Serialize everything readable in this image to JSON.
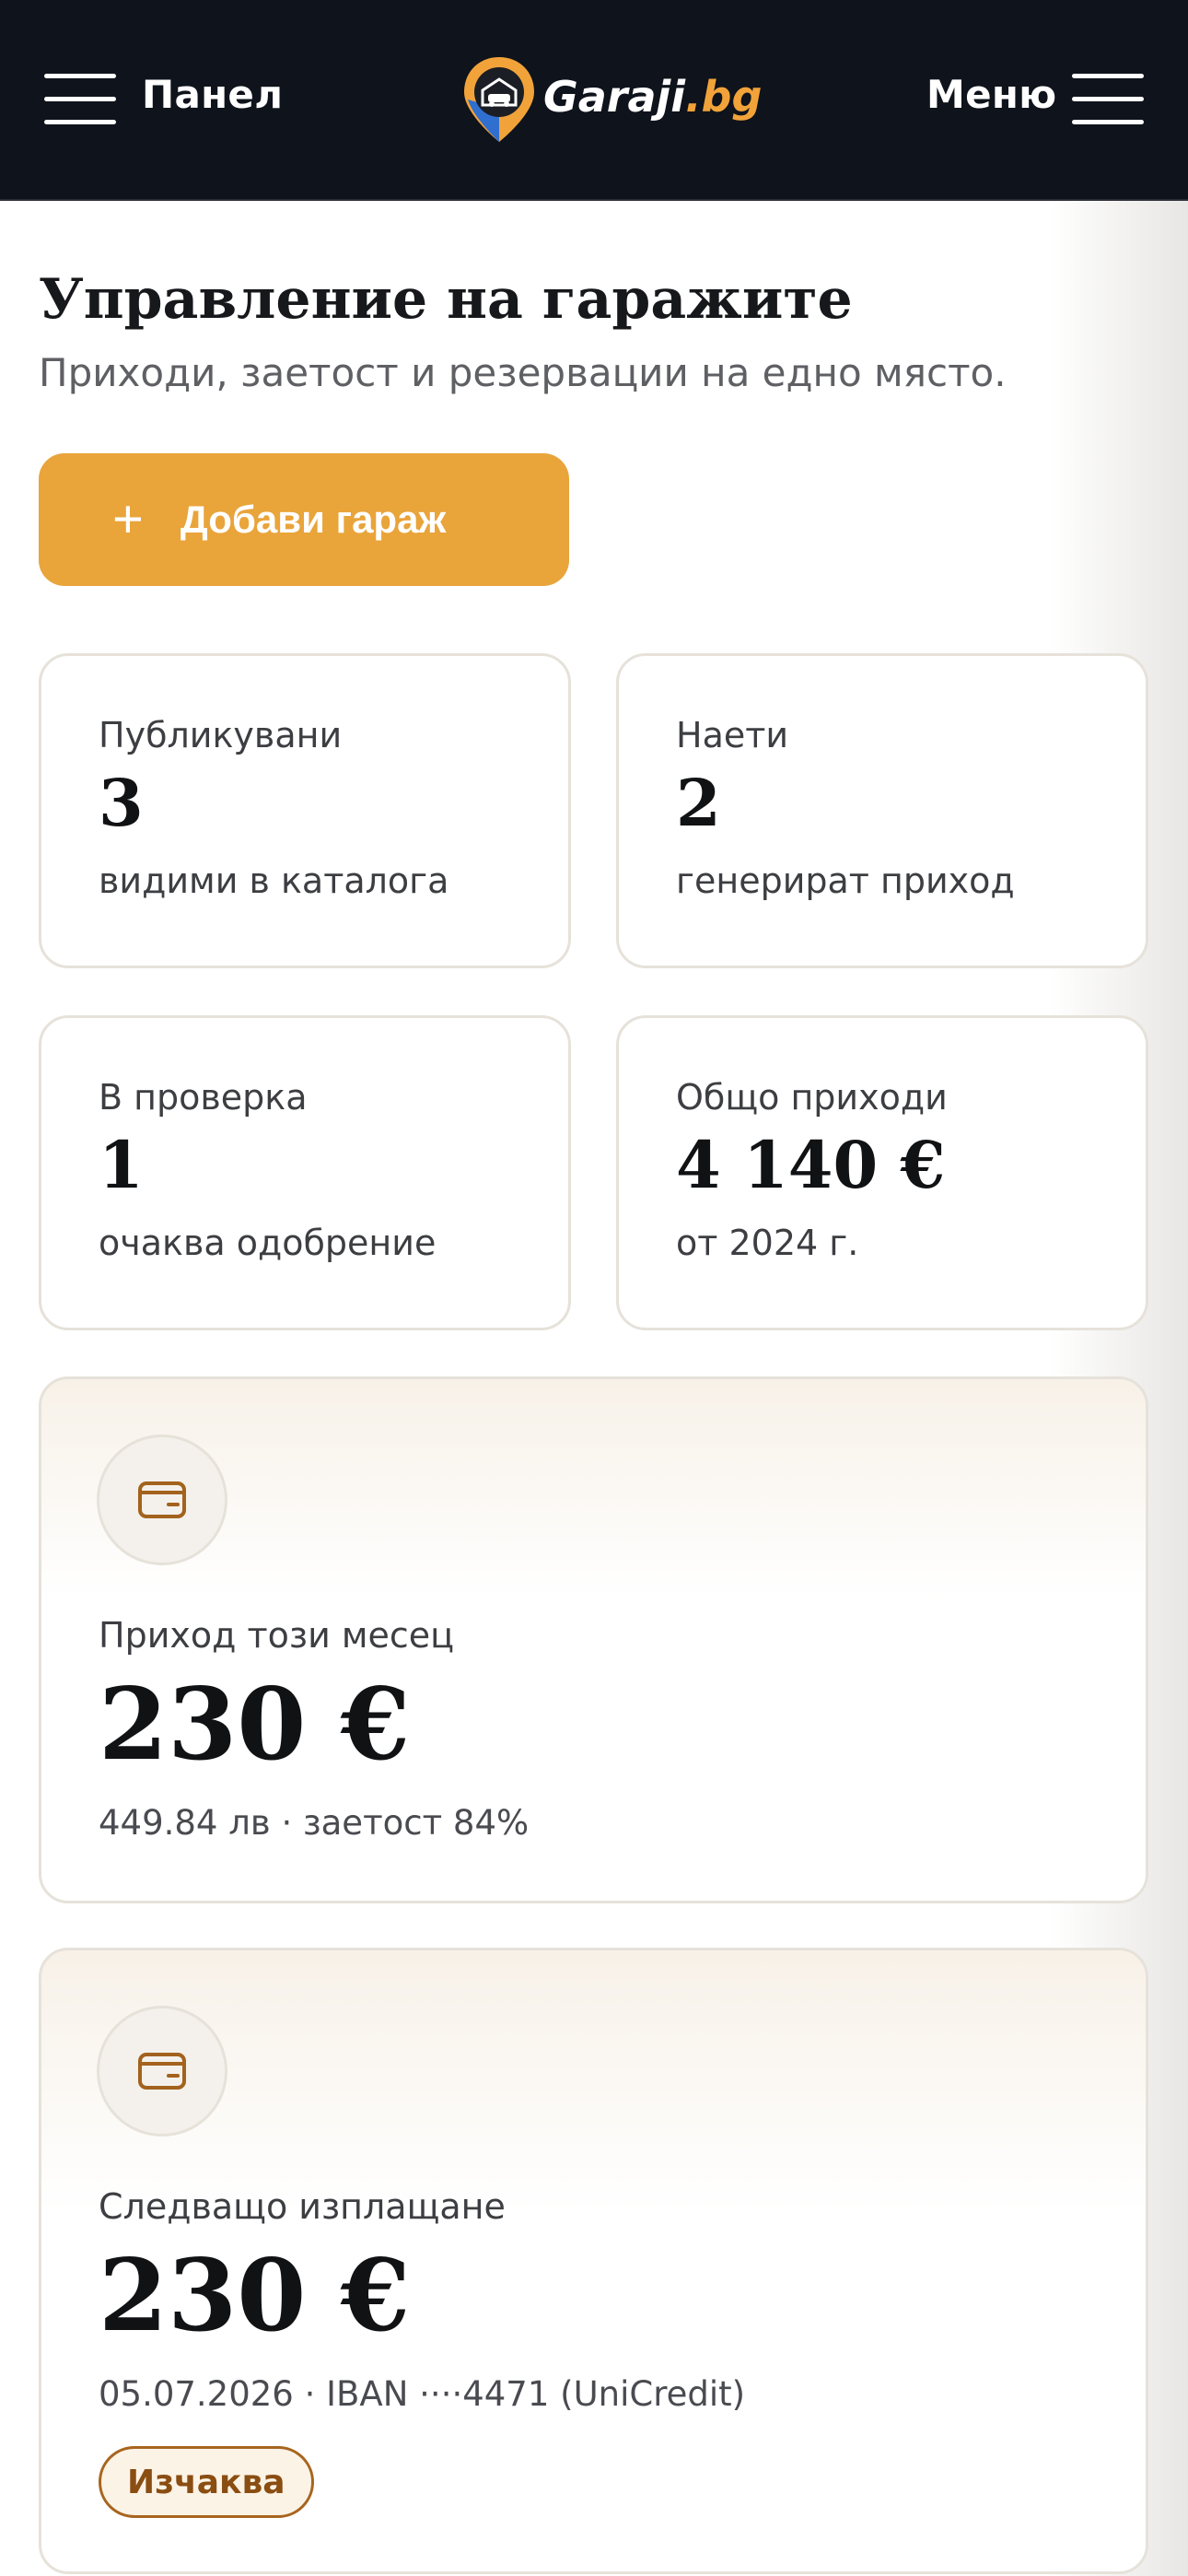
{
  "header": {
    "left_label": "Панел",
    "right_label": "Меню",
    "logo": {
      "name": "Garaji",
      "tld": ".bg"
    }
  },
  "page": {
    "title": "Управление на гаражите",
    "subtitle": "Приходи, заетост и резервации на едно място."
  },
  "actions": {
    "add_garage_label": "Добави гараж",
    "add_garage_icon": "plus-icon"
  },
  "stats": [
    {
      "label": "Публикувани",
      "value": "3",
      "note": "видими в каталога"
    },
    {
      "label": "Наети",
      "value": "2",
      "note": "генерират приход"
    },
    {
      "label": "В проверка",
      "value": "1",
      "note": "очаква одобрение"
    },
    {
      "label": "Общо приходи",
      "value": "4 140 €",
      "note": "от 2024 г."
    }
  ],
  "income_month": {
    "icon": "wallet-icon",
    "label": "Приход този месец",
    "value": "230 €",
    "note": "449.84 лв · заетост 84%"
  },
  "next_payout": {
    "icon": "wallet-icon",
    "label": "Следващо изплащане",
    "value": "230 €",
    "note": "05.07.2026 · IBAN ····4471 (UniCredit)",
    "status": "Изчаква"
  },
  "colors": {
    "header_bg": "#0f131b",
    "accent": "#e9a43a",
    "badge_border": "#a8651f",
    "wallet_icon": "#a3621d"
  }
}
